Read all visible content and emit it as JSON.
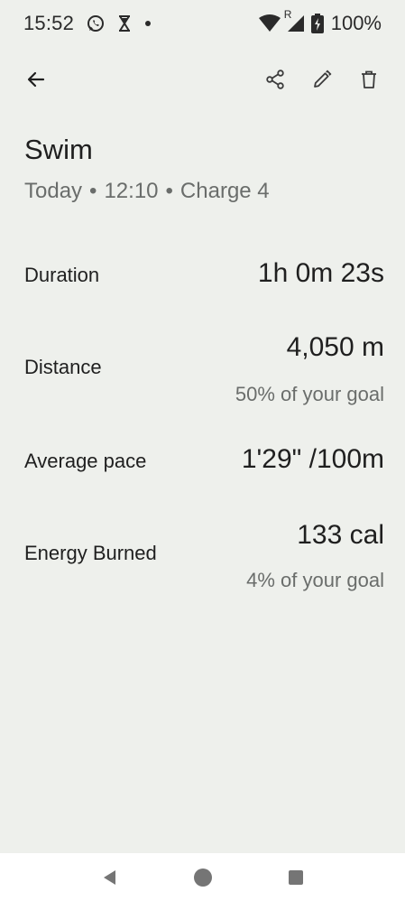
{
  "status_bar": {
    "time": "15:52",
    "left_icons": [
      "whatsapp-icon",
      "hourglass-icon",
      "dot-icon"
    ],
    "roaming_label": "R",
    "battery_percent": "100%"
  },
  "app_bar": {
    "back_icon": "arrow-left-icon",
    "actions": [
      "share-icon",
      "edit-icon",
      "delete-icon"
    ]
  },
  "activity": {
    "title": "Swim",
    "subtitle": {
      "day": "Today",
      "time": "12:10",
      "device": "Charge 4",
      "separator": "•"
    }
  },
  "metrics": [
    {
      "label": "Duration",
      "value": "1h 0m 23s",
      "goal": ""
    },
    {
      "label": "Distance",
      "value": "4,050 m",
      "goal": "50% of your goal"
    },
    {
      "label": "Average pace",
      "value": "1'29\" /100m",
      "goal": ""
    },
    {
      "label": "Energy Burned",
      "value": "133 cal",
      "goal": "4% of your goal"
    }
  ],
  "nav_bar": {
    "buttons": [
      "back-triangle-icon",
      "home-circle-icon",
      "recents-square-icon"
    ]
  },
  "colors": {
    "background": "#eef0ec",
    "text_primary": "#1f1f1f",
    "text_secondary": "#6a6d6b",
    "nav_background": "#ffffff"
  }
}
